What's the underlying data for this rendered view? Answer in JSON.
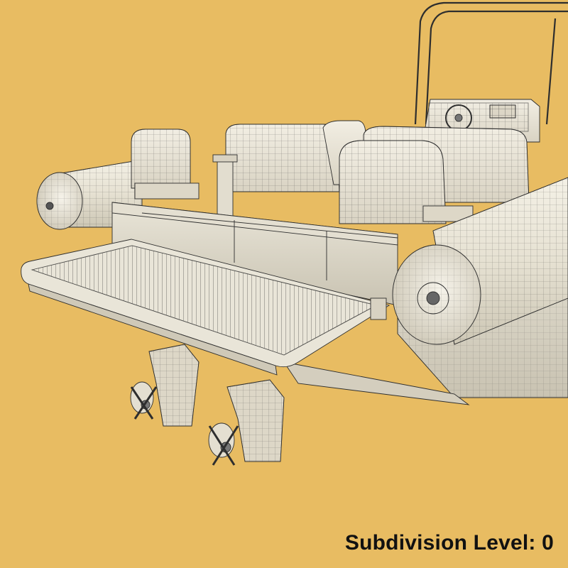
{
  "caption": {
    "text": "Subdivision Level: 0"
  },
  "scene": {
    "subject": "boat-wireframe-render",
    "colors": {
      "background": "#e8bc62",
      "model": "#ece8dc",
      "wire": "#2e2e2e",
      "caption": "#111111"
    }
  }
}
